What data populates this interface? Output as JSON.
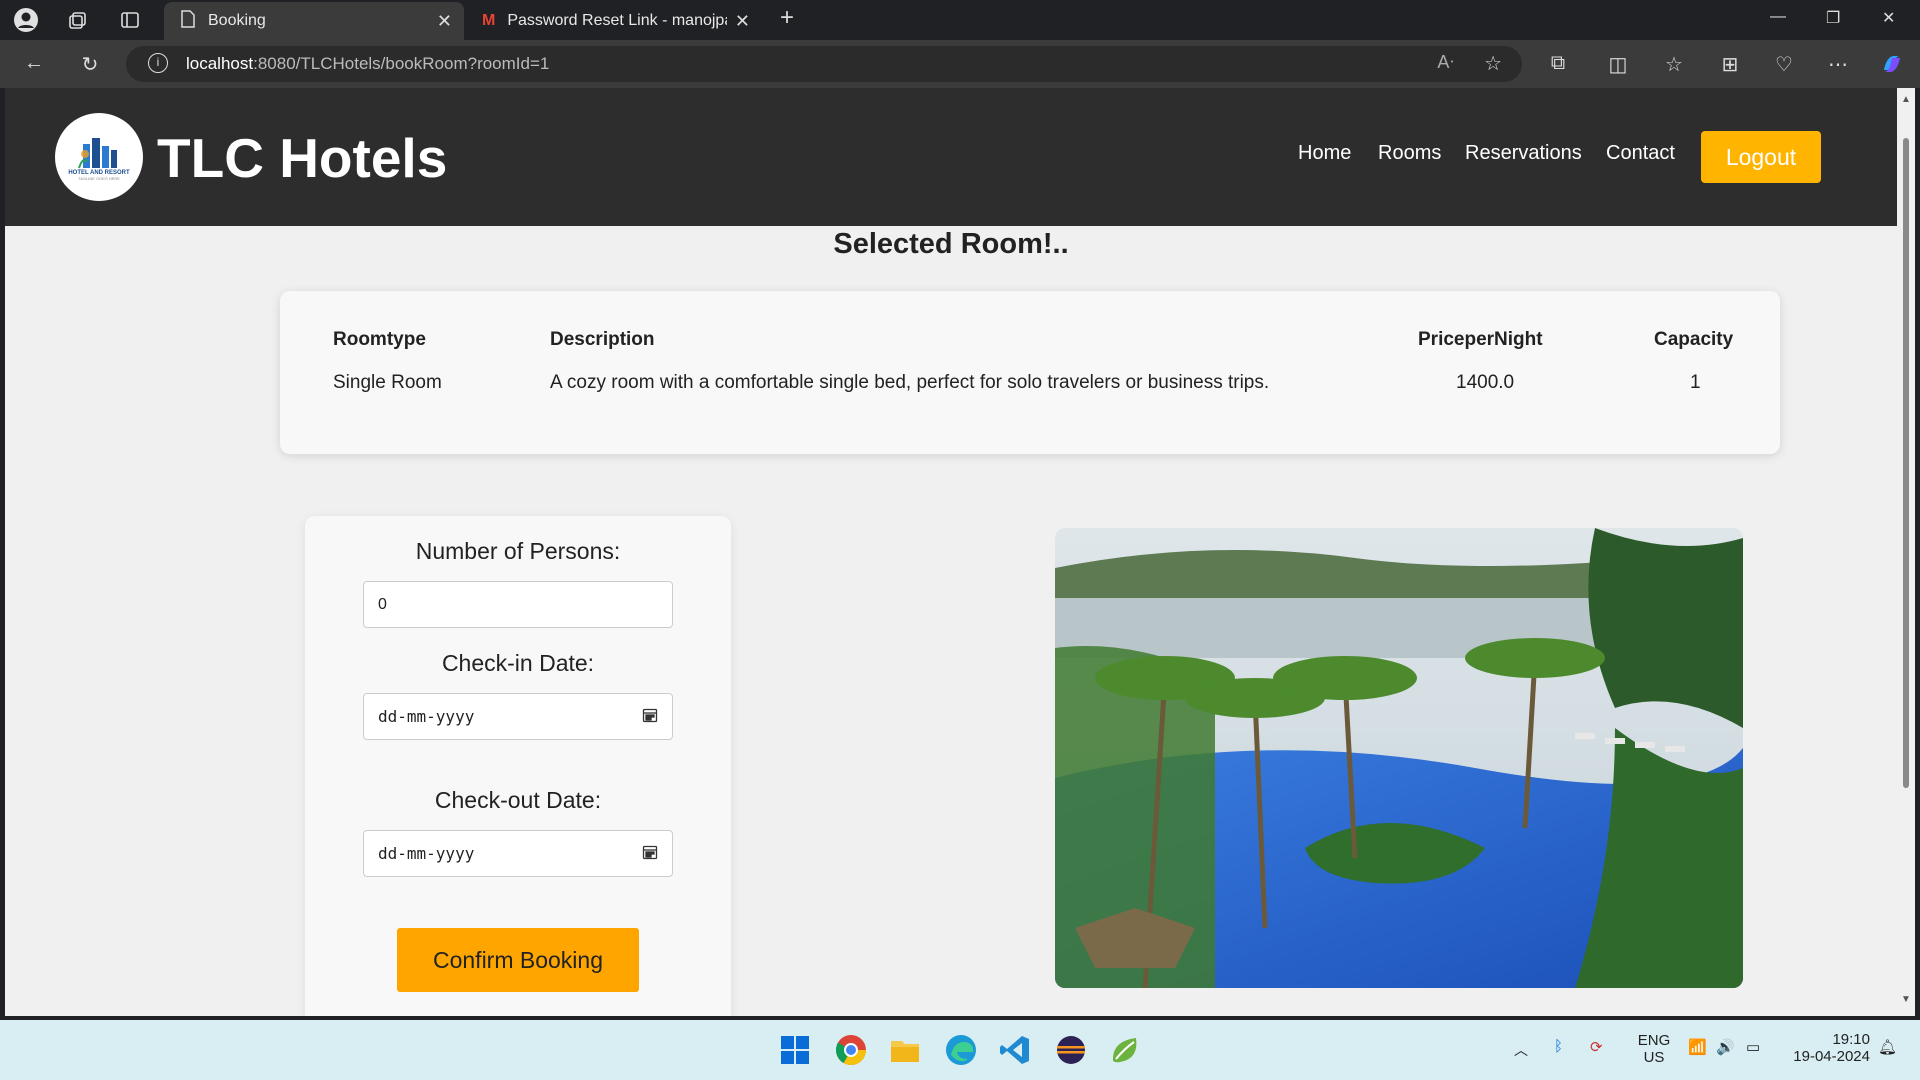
{
  "browser": {
    "tabs": [
      {
        "title": "Booking",
        "active": true
      },
      {
        "title": "Password Reset Link - manojpanc",
        "active": false
      }
    ],
    "url_host": "localhost",
    "url_path": ":8080/TLCHotels/bookRoom?roomId=1"
  },
  "site": {
    "brand": "TLC Hotels",
    "logo_text": "HOTEL AND RESORT",
    "logo_tagline": "TAGLINE GOES HERE",
    "nav": [
      "Home",
      "Rooms",
      "Reservations",
      "Contact"
    ],
    "logout_label": "Logout"
  },
  "page": {
    "title": "Selected Room!..",
    "room_table": {
      "headers": [
        "Roomtype",
        "Description",
        "PriceperNight",
        "Capacity"
      ],
      "row": [
        "Single Room",
        "A cozy room with a comfortable single bed, perfect for solo travelers or business trips.",
        "1400.0",
        "1"
      ]
    },
    "form": {
      "persons_label": "Number of Persons:",
      "persons_value": "0",
      "checkin_label": "Check-in Date:",
      "checkin_placeholder": "dd-mm-yyyy",
      "checkout_label": "Check-out Date:",
      "checkout_placeholder": "dd-mm-yyyy",
      "confirm_label": "Confirm Booking"
    }
  },
  "taskbar": {
    "lang": "ENG",
    "region": "US",
    "time": "19:10",
    "date": "19-04-2024"
  },
  "colors": {
    "accent": "#ffb400",
    "confirm": "#ffa500",
    "header_bg": "#2d2d2d"
  }
}
